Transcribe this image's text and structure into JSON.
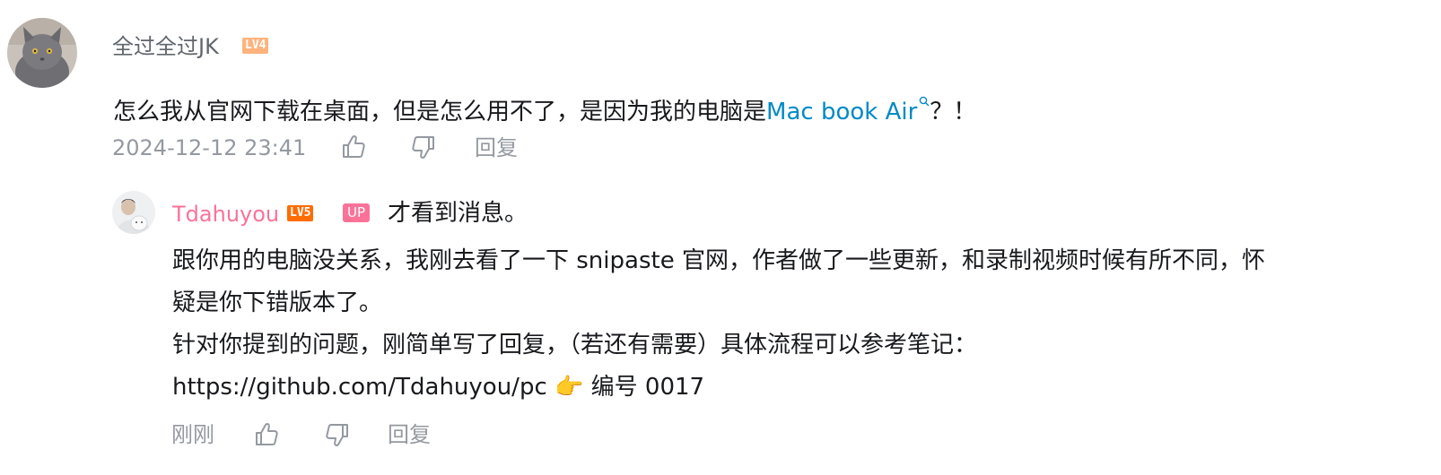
{
  "comment": {
    "username": "全过全过JK",
    "level_badge": "LV4",
    "text_before_link": "怎么我从官网下载在桌面，但是怎么用不了，是因为我的电脑是",
    "link_text": "Mac book Air",
    "text_after_link": "？！",
    "timestamp": "2024-12-12 23:41",
    "reply_label": "回复",
    "like_icon": "thumbs-up-icon",
    "dislike_icon": "thumbs-down-icon"
  },
  "reply": {
    "username": "Tdahuyou",
    "level_badge": "LV5",
    "up_badge": "UP",
    "first_line": "才看到消息。",
    "lines": [
      "跟你用的电脑没关系，我刚去看了一下 snipaste 官网，作者做了一些更新，和录制视频时候有所不同，怀",
      "疑是你下错版本了。",
      "针对你提到的问题，刚简单写了回复，（若还有需要）具体流程可以参考笔记：",
      "https://github.com/Tdahuyou/pc"
    ],
    "emoji": "👉",
    "note_number": "编号 0017",
    "timestamp": "刚刚",
    "reply_label": "回复"
  },
  "colors": {
    "username_grey": "#61666d",
    "up_pink": "#fb7299",
    "link_blue": "#008ac5",
    "meta_grey": "#9499a0",
    "lv4_orange": "#ffb37c",
    "lv5_orange": "#ff6c00"
  }
}
